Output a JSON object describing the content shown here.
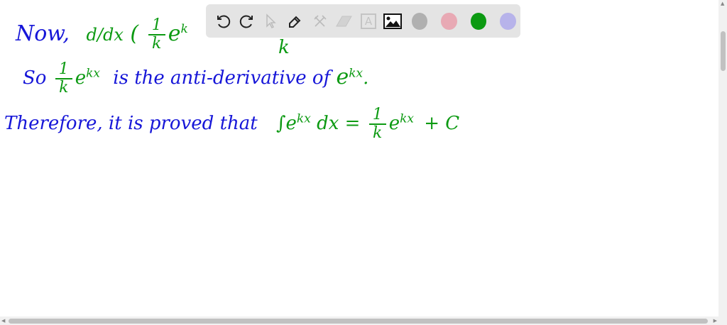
{
  "notes": {
    "line1": {
      "prefix": "Now,",
      "deriv": "d/dx",
      "paren": "(",
      "frac_num": "1",
      "frac_den": "k",
      "base": "e",
      "exp": "k",
      "denominator_tail": "k"
    },
    "line2": {
      "prefix": "So",
      "frac_num": "1",
      "frac_den": "k",
      "base": "e",
      "exp": "kx",
      "text": "is the anti-derivative of",
      "tail_base": "e",
      "tail_exp": "kx",
      "tail_end": "."
    },
    "line3": {
      "text": "Therefore, it is proved that",
      "integral": "∫e",
      "int_exp": "kx",
      "dx": "dx =",
      "frac_num": "1",
      "frac_den": "k",
      "base": "e",
      "exp": "kx",
      "plus_c": "+ C"
    }
  },
  "toolbar": {
    "tools": [
      "undo-icon",
      "redo-icon",
      "select-icon",
      "pen-icon",
      "tools-icon",
      "eraser-icon",
      "text-icon",
      "image-icon"
    ],
    "text_tool_label": "A",
    "colors": [
      "#b0b0b0",
      "#e8a9b4",
      "#0c9a12",
      "#b7b3ea"
    ]
  }
}
